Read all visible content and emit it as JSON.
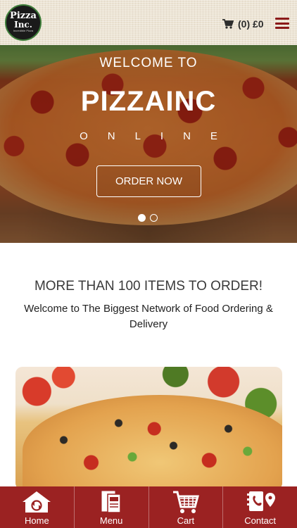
{
  "header": {
    "logo": {
      "line1": "Pizza",
      "line2": "Inc.",
      "line3": "Incredible Pizza"
    },
    "cart": {
      "icon": "cart-icon",
      "summary": "(0) £0"
    },
    "menu_icon": "hamburger-icon"
  },
  "hero": {
    "welcome": "WELCOME TO",
    "title": "PIZZAINC",
    "subtitle": "ONLINE",
    "order_button": "ORDER NOW",
    "slides": 2,
    "active_slide": 1
  },
  "intro": {
    "heading": "MORE THAN 100 ITEMS TO ORDER!",
    "text": "Welcome to The Biggest Network of Food Ordering & Delivery"
  },
  "bottom_nav": {
    "items": [
      {
        "label": "Home",
        "icon": "home-icon"
      },
      {
        "label": "Menu",
        "icon": "menu-book-icon"
      },
      {
        "label": "Cart",
        "icon": "cart-icon"
      },
      {
        "label": "Contact",
        "icon": "contact-icon"
      }
    ]
  },
  "colors": {
    "brand_red": "#9b2222",
    "header_bg": "#ece4d4",
    "accent_dark": "#8b1a1a"
  }
}
